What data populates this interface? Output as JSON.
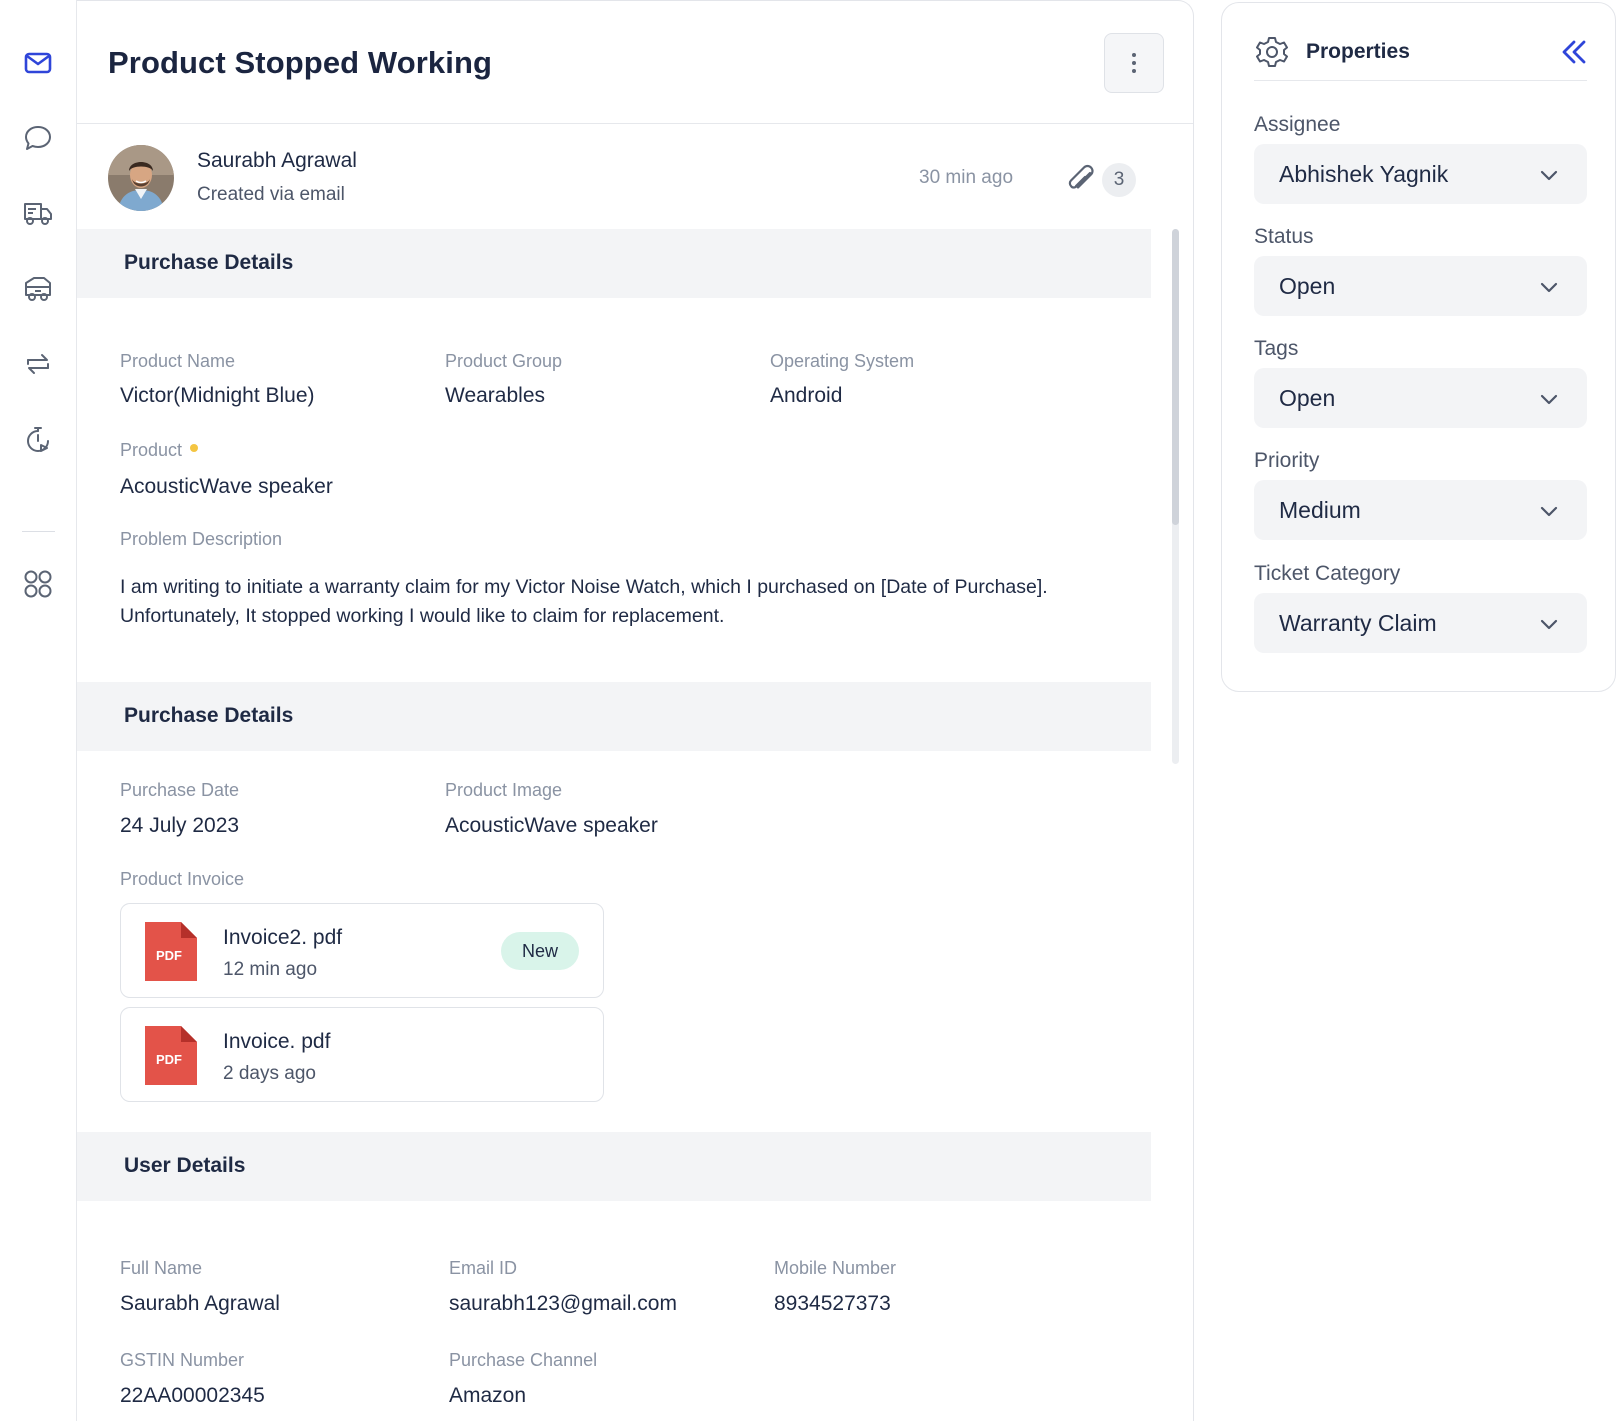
{
  "nav": {
    "icons": [
      "mail-icon",
      "chat-bubble-icon",
      "truck-icon",
      "delivery-icon",
      "exchange-icon",
      "timer-icon",
      "apps-grid-icon"
    ],
    "accent": "#2f45d9"
  },
  "ticket": {
    "title": "Product Stopped Working",
    "author": "Saurabh Agrawal",
    "source": "Created via email",
    "time": "30 min ago",
    "attachments": "3"
  },
  "purchase_details": {
    "heading": "Purchase Details",
    "product_name_label": "Product  Name",
    "product_name": "Victor(Midnight Blue)",
    "product_group_label": "Product Group",
    "product_group": "Wearables",
    "os_label": "Operating System",
    "os": "Android",
    "product_label": "Product",
    "product": "AcousticWave speaker",
    "problem_label": "Problem Description",
    "problem": "I am writing to initiate a warranty claim for my Victor Noise Watch, which I purchased on [Date of Purchase]. Unfortunately, It stopped working I would like to claim for replacement."
  },
  "purchase_details_2": {
    "heading": "Purchase Details",
    "date_label": "Purchase Date",
    "date": "24 July 2023",
    "image_label": "Product Image",
    "image": "AcousticWave speaker",
    "invoice_label": "Product Invoice",
    "files": [
      {
        "name": "Invoice2. pdf",
        "time": "12 min ago",
        "badge": "New",
        "icon_text": "PDF"
      },
      {
        "name": "Invoice. pdf",
        "time": "2 days ago",
        "icon_text": "PDF"
      }
    ]
  },
  "user_details": {
    "heading": "User Details",
    "full_name_label": "Full Name",
    "full_name": "Saurabh Agrawal",
    "email_label": "Email ID",
    "email": "saurabh123@gmail.com",
    "mobile_label": "Mobile Number",
    "mobile": "8934527373",
    "gstin_label": "GSTIN Number",
    "gstin": "22AA00002345",
    "channel_label": "Purchase Channel",
    "channel": "Amazon"
  },
  "properties": {
    "title": "Properties",
    "fields": [
      {
        "label": "Assignee",
        "value": "Abhishek Yagnik"
      },
      {
        "label": "Status",
        "value": "Open"
      },
      {
        "label": "Tags",
        "value": "Open"
      },
      {
        "label": "Priority",
        "value": "Medium"
      },
      {
        "label": "Ticket Category",
        "value": "Warranty Claim"
      }
    ]
  }
}
